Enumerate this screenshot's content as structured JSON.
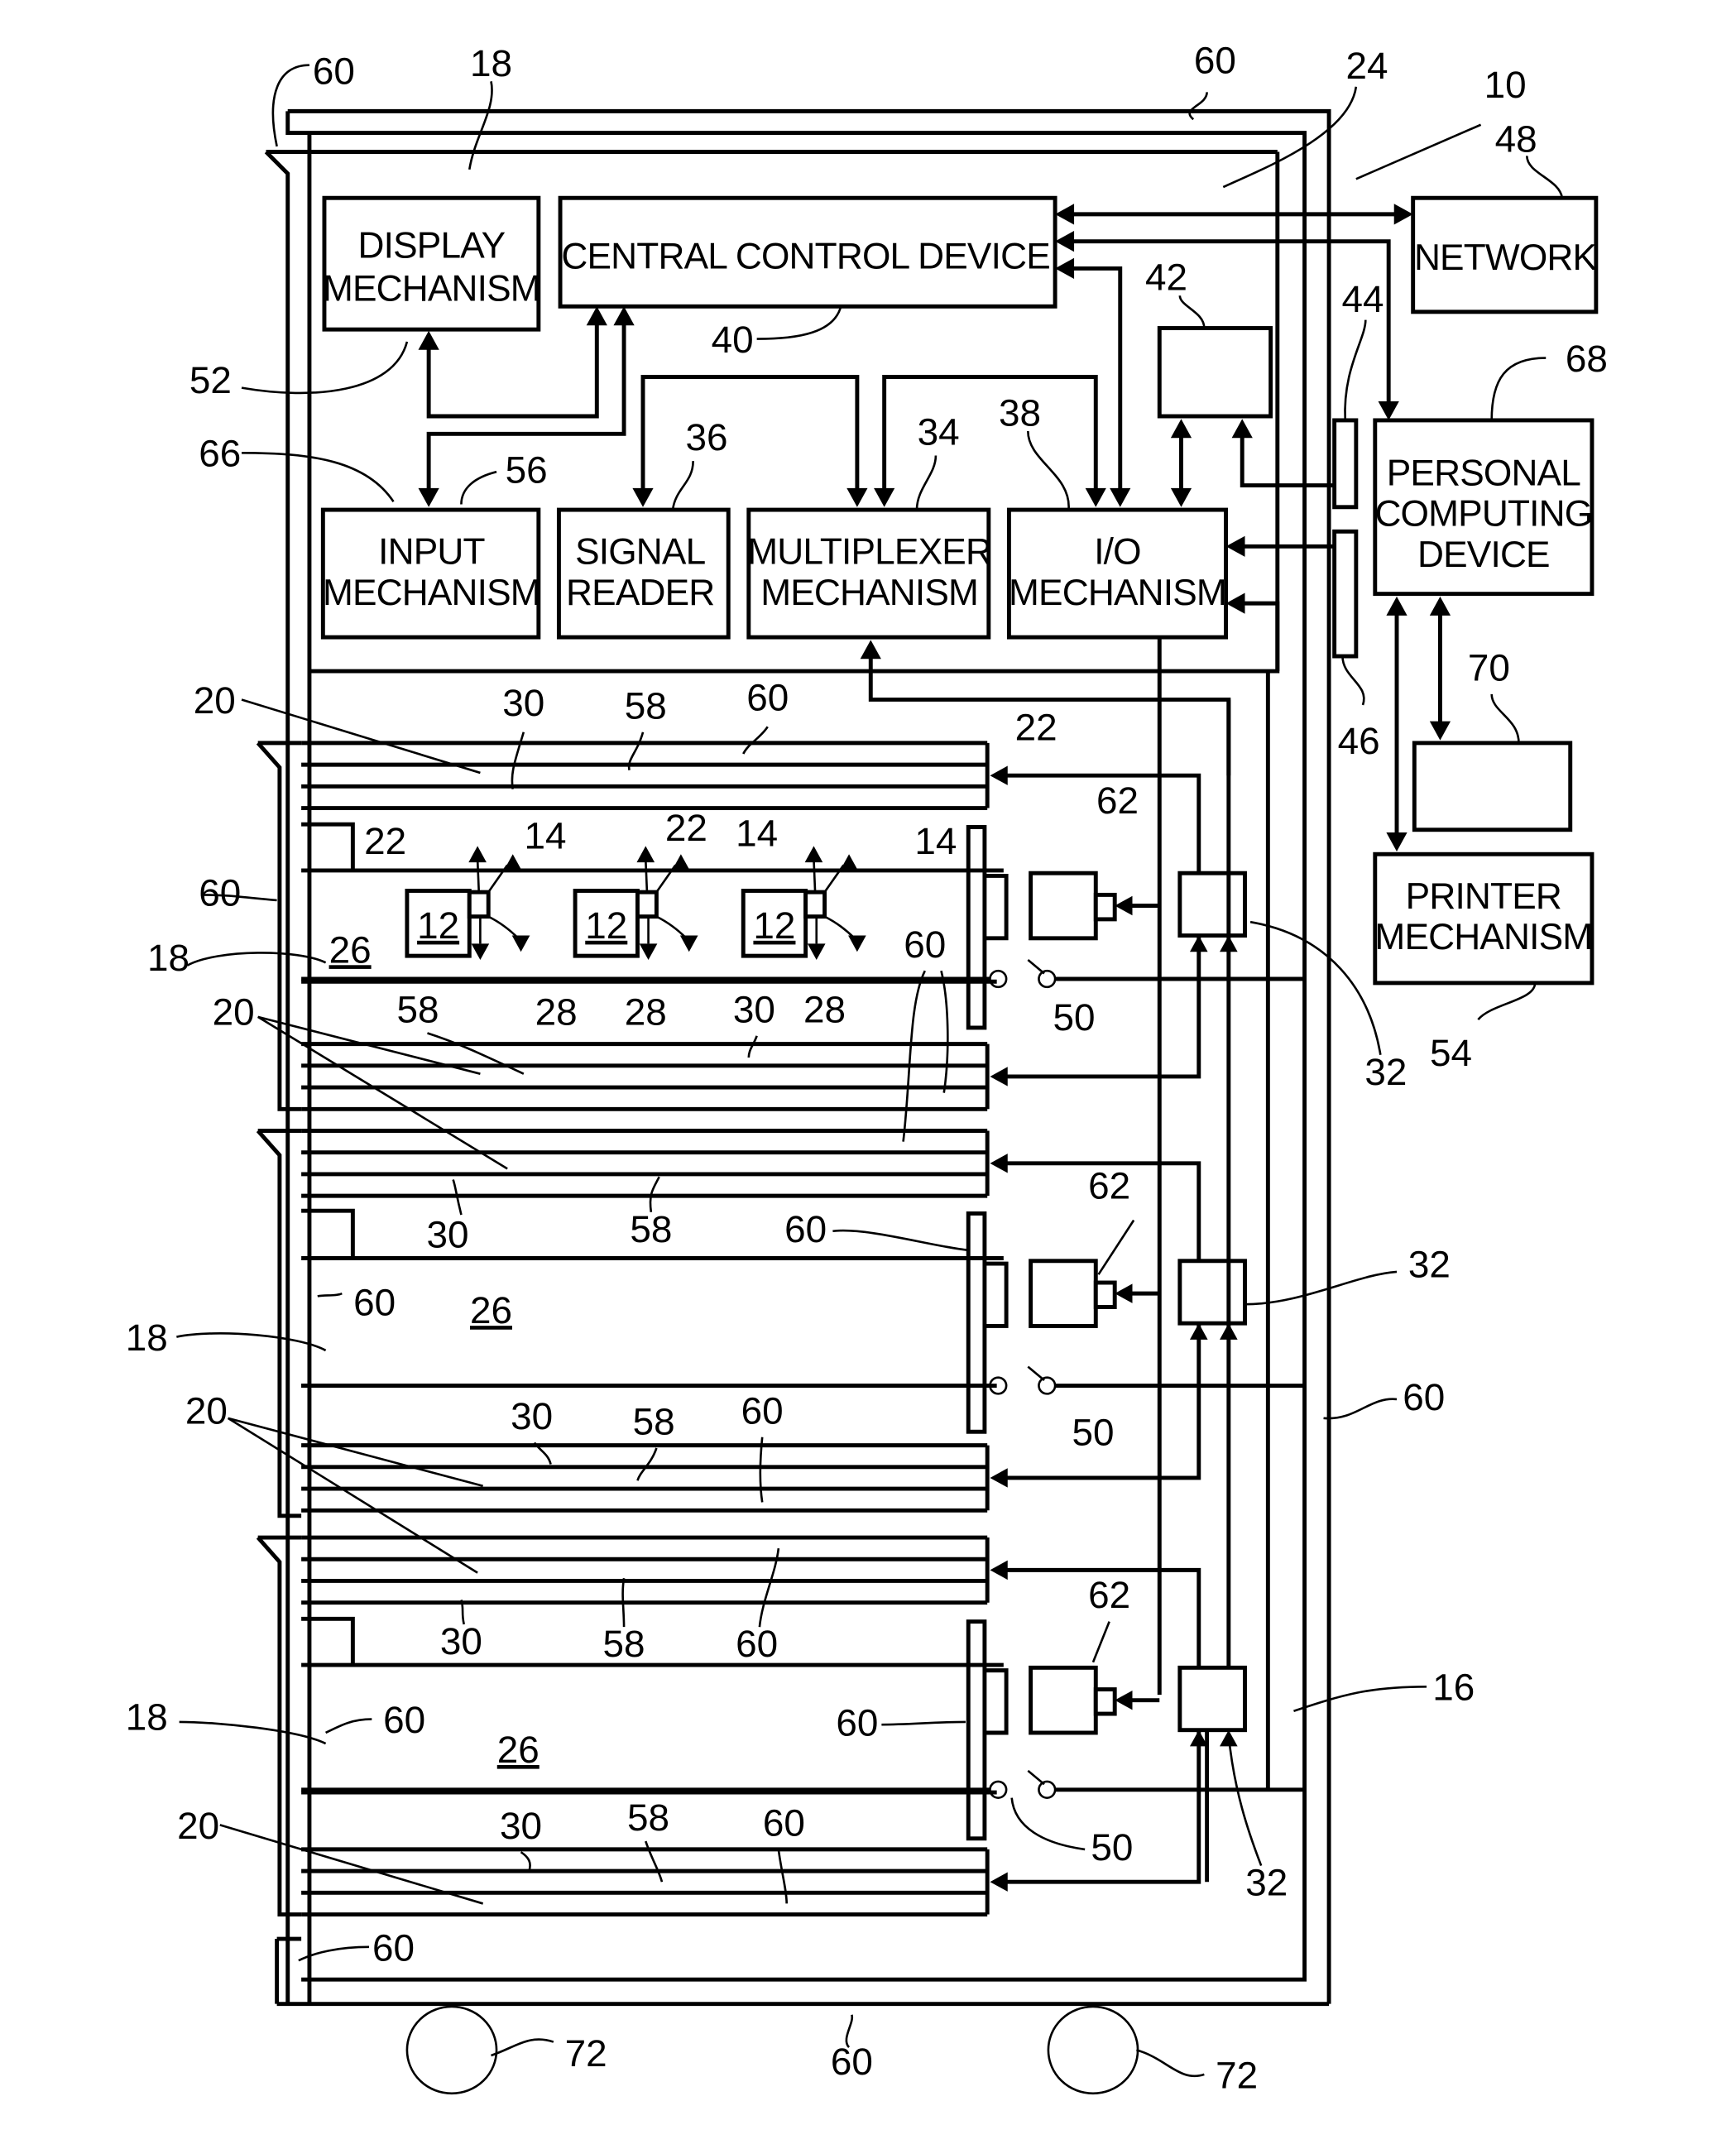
{
  "figure": {
    "type": "patent block diagram",
    "description": "Mobile cabinet with drawers, electronic sensing, central control and peripherals"
  },
  "blocks": {
    "display": [
      "DISPLAY",
      "MECHANISM"
    ],
    "central": [
      "CENTRAL CONTROL DEVICE"
    ],
    "input": [
      "INPUT",
      "MECHANISM"
    ],
    "signal": [
      "SIGNAL",
      "READER"
    ],
    "multiplexer": [
      "MULTIPLEXER",
      "MECHANISM"
    ],
    "io": [
      "I/O",
      "MECHANISM"
    ],
    "network": [
      "NETWORK"
    ],
    "pc": [
      "PERSONAL",
      "COMPUTING",
      "DEVICE"
    ],
    "printer": [
      "PRINTER",
      "MECHANISM"
    ]
  },
  "refs": {
    "r10": "10",
    "r12": "12",
    "r14": "14",
    "r16": "16",
    "r18": "18",
    "r20": "20",
    "r22": "22",
    "r24": "24",
    "r26": "26",
    "r28": "28",
    "r30": "30",
    "r32": "32",
    "r34": "34",
    "r36": "36",
    "r38": "38",
    "r40": "40",
    "r42": "42",
    "r44": "44",
    "r46": "46",
    "r48": "48",
    "r50": "50",
    "r52": "52",
    "r54": "54",
    "r56": "56",
    "r58": "58",
    "r60": "60",
    "r62": "62",
    "r66": "66",
    "r68": "68",
    "r70": "70",
    "r72": "72"
  }
}
